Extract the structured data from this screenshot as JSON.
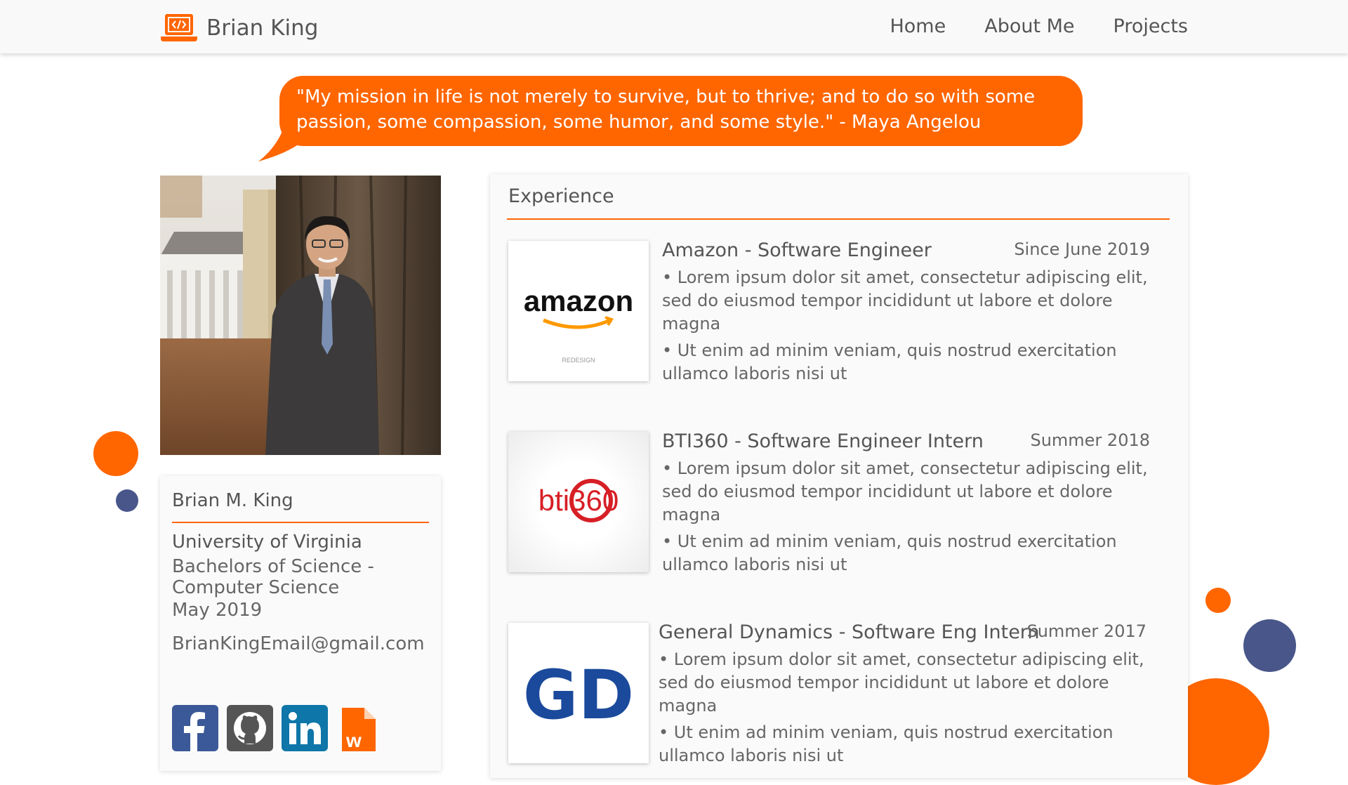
{
  "nav": {
    "brand": "Brian King",
    "links": [
      "Home",
      "About Me",
      "Projects"
    ]
  },
  "quote": {
    "text": "\"My mission in life is not merely to survive, but to thrive; and to do so with some passion, some compassion, some humor, and some style.\" - Maya Angelou"
  },
  "profile": {
    "name": "Brian M. King",
    "university": "University of Virginia",
    "degree": "Bachelors of Science - Computer Science",
    "date": "May 2019",
    "email": "BrianKingEmail@gmail.com",
    "socials": [
      "facebook-icon",
      "github-icon",
      "linkedin-icon",
      "wordpress-doc-icon"
    ]
  },
  "experience": {
    "title": "Experience",
    "jobs": [
      {
        "title": "Amazon - Software Engineer",
        "date": "Since June 2019",
        "logo_text": "amazon",
        "logo_subtext": "REDESIGN",
        "bullets": [
          "• Lorem ipsum dolor sit amet, consectetur adipiscing elit, sed do eiusmod tempor incididunt ut labore et dolore magna",
          "• Ut enim ad minim veniam, quis nostrud exercitation ullamco laboris nisi ut"
        ]
      },
      {
        "title": "BTI360 - Software Engineer Intern",
        "date": "Summer 2018",
        "logo_text": "bti360",
        "bullets": [
          "• Lorem ipsum dolor sit amet, consectetur adipiscing elit, sed do eiusmod tempor incididunt ut labore et dolore magna",
          "• Ut enim ad minim veniam, quis nostrud exercitation ullamco laboris nisi ut"
        ]
      },
      {
        "title": "General Dynamics - Software Eng Intern",
        "date": "Summer 2017",
        "logo_text": "GD",
        "bullets": [
          "• Lorem ipsum dolor sit amet, consectetur adipiscing elit, sed do eiusmod tempor incididunt ut labore et dolore magna",
          "• Ut enim ad minim veniam, quis nostrud exercitation ullamco laboris nisi ut"
        ]
      }
    ]
  },
  "colors": {
    "accent": "#ff6600",
    "navy": "#48568a",
    "text": "#555555"
  }
}
